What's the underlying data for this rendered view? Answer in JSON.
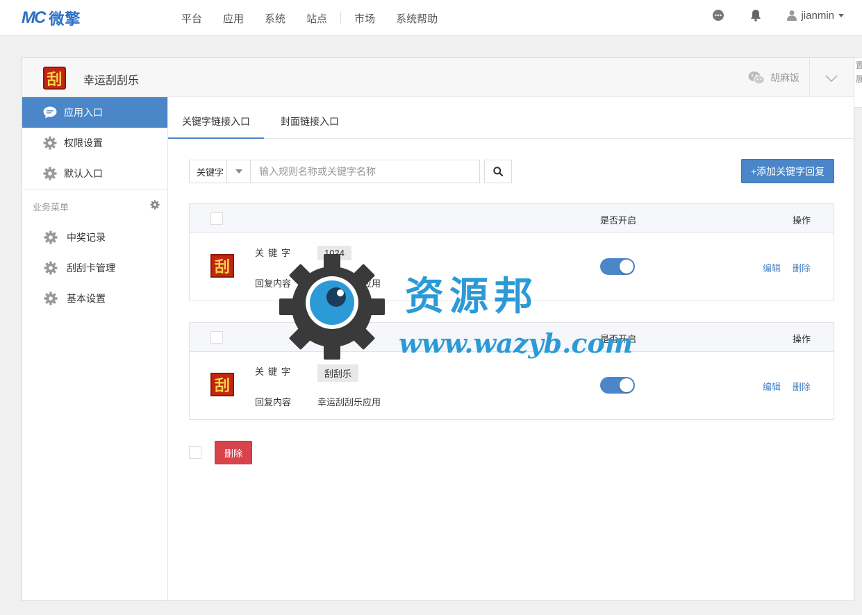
{
  "brand": {
    "mark": "MC",
    "name": "微擎"
  },
  "topnav": {
    "items": [
      "平台",
      "应用",
      "系统",
      "站点"
    ],
    "items2": [
      "市场",
      "系统帮助"
    ],
    "username": "jianmin"
  },
  "app": {
    "name": "幸运刮刮乐",
    "logo_char": "刮",
    "account_name": "胡麻饭"
  },
  "side_tab_text": "置展",
  "sidebar": {
    "items": [
      {
        "label": "应用入口",
        "icon": "chat-icon",
        "active": true
      },
      {
        "label": "权限设置",
        "icon": "gear-icon"
      },
      {
        "label": "默认入口",
        "icon": "gear-icon"
      }
    ],
    "section_title": "业务菜单",
    "business_items": [
      {
        "label": "中奖记录",
        "icon": "gear-icon"
      },
      {
        "label": "刮刮卡管理",
        "icon": "gear-icon"
      },
      {
        "label": "基本设置",
        "icon": "gear-icon"
      }
    ]
  },
  "tabs": [
    {
      "label": "关键字链接入口",
      "active": true
    },
    {
      "label": "封面链接入口",
      "active": false
    }
  ],
  "search": {
    "select_value": "关键字",
    "placeholder": "输入规则名称或关键字名称"
  },
  "add_button_label": "+添加关键字回复",
  "table_headers": {
    "enabled": "是否开启",
    "actions": "操作"
  },
  "labels": {
    "keyword": "关键字",
    "reply": "回复内容"
  },
  "rules": [
    {
      "keyword": "1024",
      "reply": "幸运刮刮乐应用",
      "enabled": true,
      "edit": "编辑",
      "delete": "删除"
    },
    {
      "keyword": "刮刮乐",
      "reply": "幸运刮刮乐应用",
      "enabled": true,
      "edit": "编辑",
      "delete": "删除"
    }
  ],
  "bulk_delete_label": "删除",
  "watermark": {
    "title": "资源邦",
    "url": "www.wazyb.com"
  },
  "colors": {
    "primary": "#4a86c8",
    "danger": "#d9434b",
    "watermark": "#2b9ad6",
    "logo_red": "#c2260f",
    "logo_yellow": "#f6d34a"
  }
}
